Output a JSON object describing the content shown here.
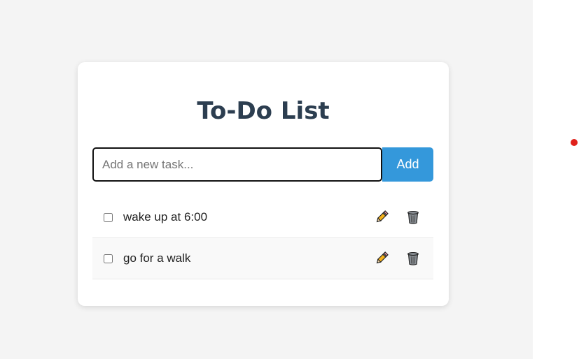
{
  "app": {
    "title": "To-Do List"
  },
  "form": {
    "placeholder": "Add a new task...",
    "value": "",
    "add_label": "Add"
  },
  "tasks": [
    {
      "text": "wake up at 6:00",
      "checked": false
    },
    {
      "text": "go for a walk",
      "checked": false
    }
  ],
  "icons": {
    "edit": "pencil-icon",
    "delete": "trash-icon"
  },
  "colors": {
    "accent": "#3498db",
    "title": "#2c3e50",
    "background": "#f4f4f4",
    "indicator": "#e0211b"
  }
}
